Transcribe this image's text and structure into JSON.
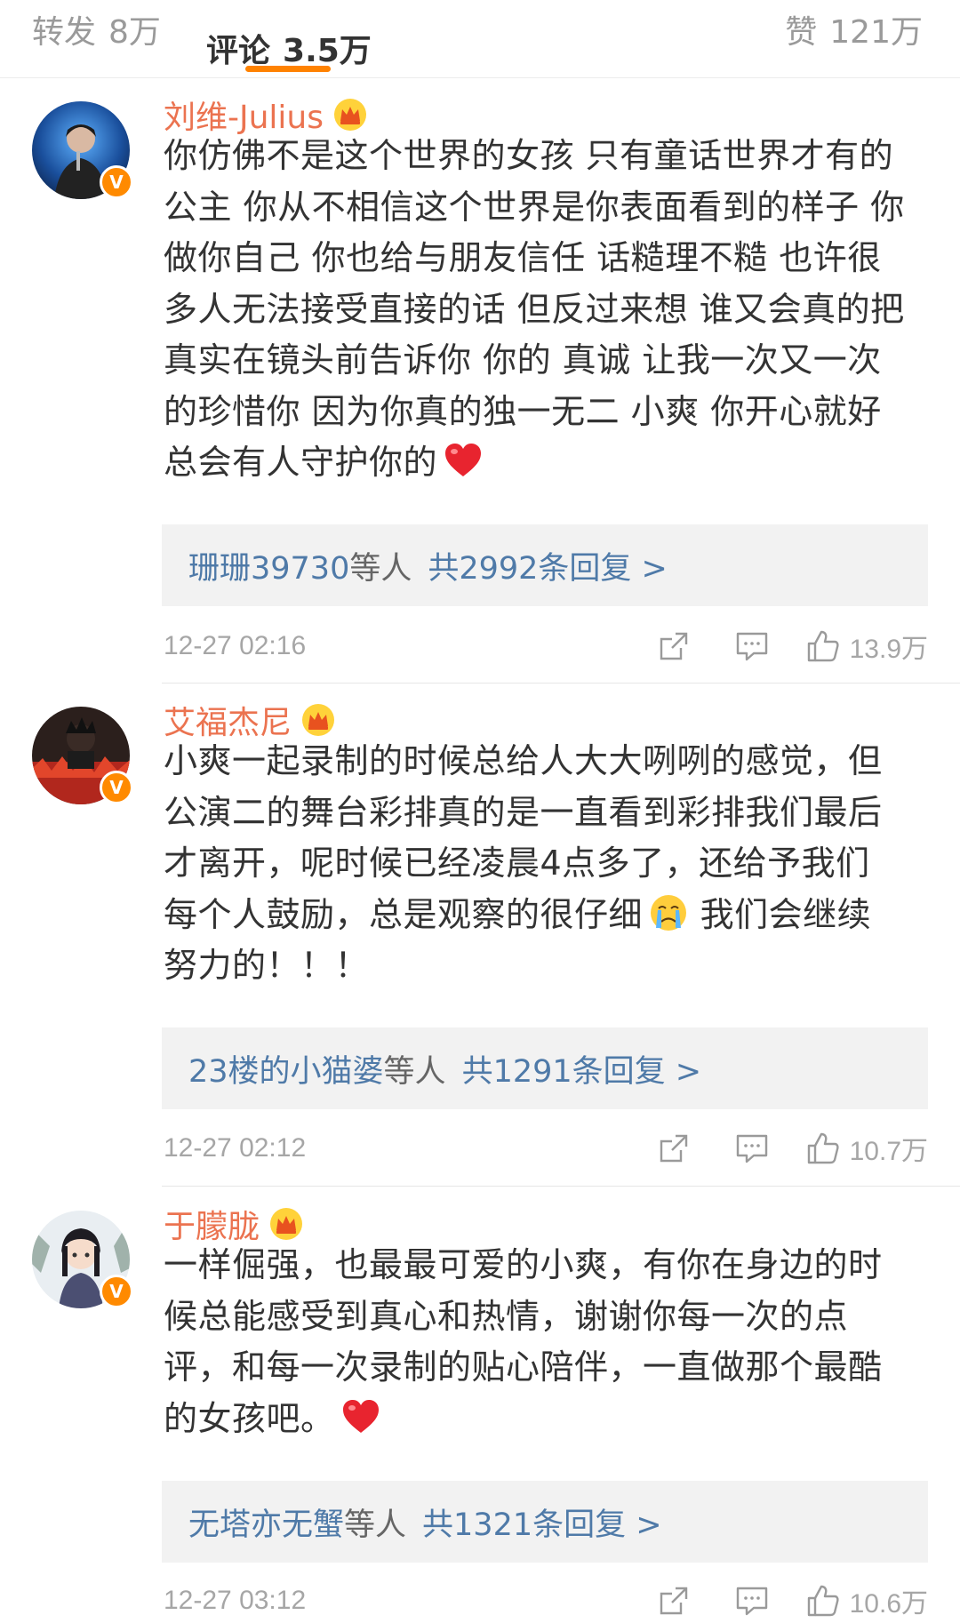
{
  "tabs": {
    "repost": {
      "label": "转发",
      "count": "8万"
    },
    "comment": {
      "label": "评论",
      "count": "3.5万"
    },
    "like": {
      "label": "赞",
      "count": "121万"
    }
  },
  "accent_color": "#ff8200",
  "username_color": "#eb7350",
  "link_color": "#4f7aa8",
  "comments": [
    {
      "username": "刘维-Julius",
      "verified": true,
      "badge_icon": "crown-icon",
      "lines": [
        "你仿佛不是这个世界的女孩 只有童话世界才有的",
        "公主 你从不相信这个世界是你表面看到的样子 你",
        "做你自己 你也给与朋友信任 话糙理不糙 也许很",
        "多人无法接受直接的话 但反过来想 谁又会真的把",
        "真实在镜头前告诉你 你的 真诚 让我一次又一次",
        "的珍惜你 因为你真的独一无二 小爽 你开心就好",
        "总会有人守护你的"
      ],
      "trailing_emoji": "heart-icon",
      "replies": {
        "first_name": "珊珊39730",
        "others": "等人",
        "total": "共2992条回复 >"
      },
      "time": "12-27 02:16",
      "likes": "13.9万"
    },
    {
      "username": "艾福杰尼",
      "verified": true,
      "badge_icon": "crown-icon",
      "lines": [
        "小爽一起录制的时候总给人大大咧咧的感觉，但",
        "公演二的舞台彩排真的是一直看到彩排我们最后",
        "才离开，呢时候已经凌晨4点多了，还给予我们",
        "每个人鼓励，总是观察的很仔细",
        "努力的！！！"
      ],
      "inline_emoji": "crying-face-icon",
      "line4_tail": " 我们会继续",
      "replies": {
        "first_name": "23楼的小猫婆",
        "others": "等人",
        "total": "共1291条回复 >"
      },
      "time": "12-27 02:12",
      "likes": "10.7万"
    },
    {
      "username": "于朦胧",
      "verified": true,
      "badge_icon": "crown-icon",
      "lines": [
        "一样倔强，也最最可爱的小爽，有你在身边的时",
        "候总能感受到真心和热情，谢谢你每一次的点",
        "评，和每一次录制的贴心陪伴，一直做那个最酷",
        "的女孩吧。"
      ],
      "trailing_emoji": "heart-icon",
      "replies": {
        "first_name": "无塔亦无蟹",
        "others": "等人",
        "total": "共1321条回复 >"
      },
      "time": "12-27 03:12",
      "likes": "10.6万"
    }
  ]
}
